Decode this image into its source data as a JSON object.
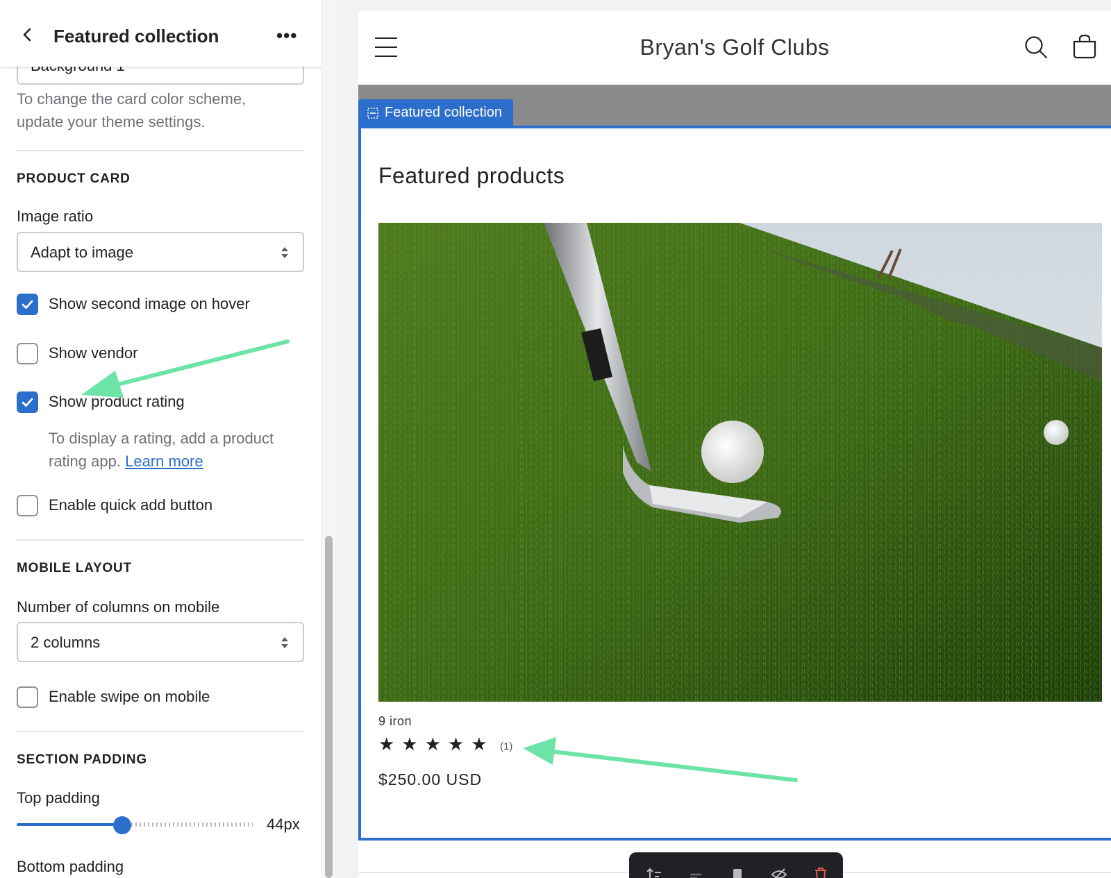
{
  "panel": {
    "title": "Featured collection",
    "more_label": "•••",
    "partial_select_value": "Background 1",
    "card_color_help": "To change the card color scheme, update your theme settings.",
    "product_card": {
      "heading": "PRODUCT CARD",
      "image_ratio_label": "Image ratio",
      "image_ratio_value": "Adapt to image",
      "show_second_image": {
        "label": "Show second image on hover",
        "checked": true
      },
      "show_vendor": {
        "label": "Show vendor",
        "checked": false
      },
      "show_rating": {
        "label": "Show product rating",
        "checked": true
      },
      "rating_help_text": "To display a rating, add a product",
      "rating_help_text2": "rating app.",
      "learn_more": "Learn more",
      "quick_add": {
        "label": "Enable quick add button",
        "checked": false
      }
    },
    "mobile_layout": {
      "heading": "MOBILE LAYOUT",
      "columns_label": "Number of columns on mobile",
      "columns_value": "2 columns",
      "swipe": {
        "label": "Enable swipe on mobile",
        "checked": false
      }
    },
    "section_padding": {
      "heading": "SECTION PADDING",
      "top_label": "Top padding",
      "top_value": "44px",
      "bottom_label": "Bottom padding"
    }
  },
  "preview": {
    "store_name": "Bryan's Golf Clubs",
    "section_tag": "Featured collection",
    "featured_title": "Featured products",
    "product": {
      "title": "9 iron",
      "stars": "★★★★★",
      "rating_count": "(1)",
      "price": "$250.00 USD"
    }
  },
  "colors": {
    "accent": "#2c6ecb",
    "annotation_arrow": "#6de3a8"
  },
  "icons": [
    "chevron-left-icon",
    "more-horizontal-icon",
    "hamburger-icon",
    "search-icon",
    "cart-icon",
    "section-icon"
  ]
}
